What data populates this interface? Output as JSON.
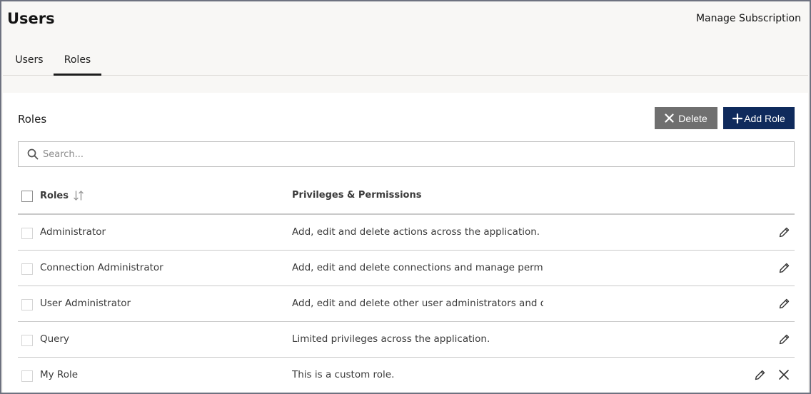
{
  "header": {
    "title": "Users",
    "manage_subscription": "Manage Subscription"
  },
  "tabs": [
    {
      "label": "Users",
      "active": false
    },
    {
      "label": "Roles",
      "active": true
    }
  ],
  "panel": {
    "title": "Roles",
    "delete_label": "Delete",
    "add_label": "Add Role",
    "delete_icon": "x-icon",
    "add_icon": "plus-icon"
  },
  "search": {
    "placeholder": "Search...",
    "value": ""
  },
  "table": {
    "columns": [
      "Roles",
      "Privileges & Permissions"
    ],
    "rows": [
      {
        "name": "Administrator",
        "permissions": "Add, edit and delete actions across the application.",
        "custom": false
      },
      {
        "name": "Connection Administrator",
        "permissions": "Add, edit and delete connections and manage permi...",
        "custom": false
      },
      {
        "name": "User Administrator",
        "permissions": "Add, edit and delete other user administrators and q...",
        "custom": false
      },
      {
        "name": "Query",
        "permissions": "Limited privileges across the application.",
        "custom": false
      },
      {
        "name": "My Role",
        "permissions": "This is a custom role.",
        "custom": true
      }
    ]
  },
  "colors": {
    "accent": "#0f2a5c",
    "delete_button": "#6f6f6f",
    "page_background": "#f8f7f5"
  }
}
